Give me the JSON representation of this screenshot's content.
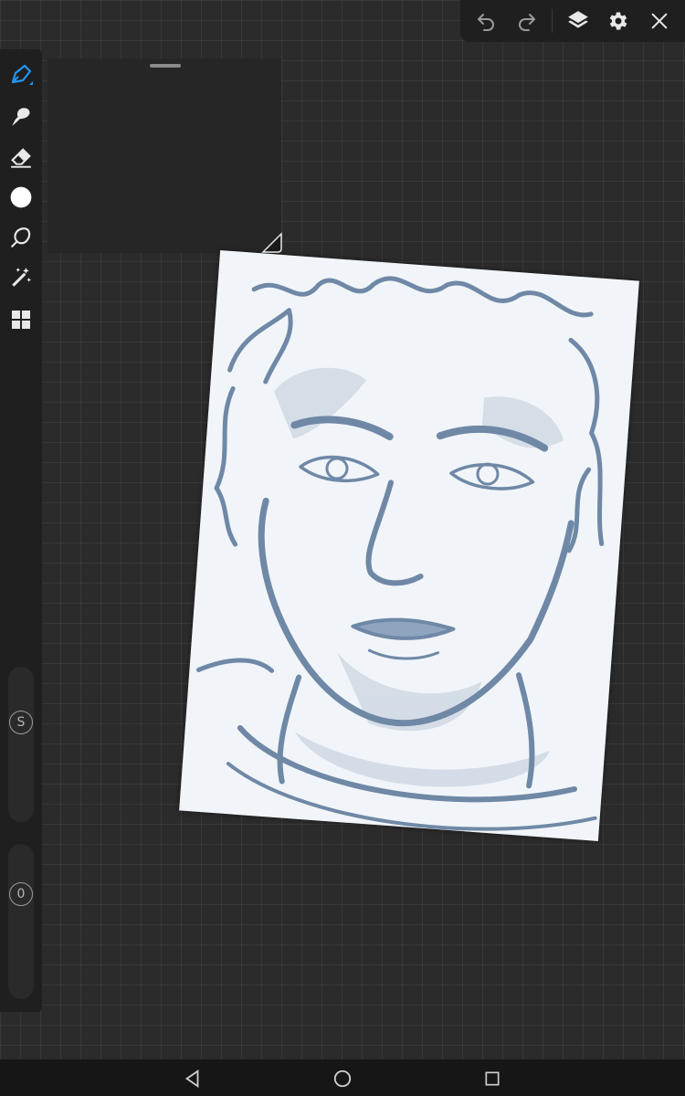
{
  "toolbar": {
    "icons": [
      "undo-icon",
      "redo-icon",
      "layers-icon",
      "settings-icon",
      "close-icon"
    ]
  },
  "tools": {
    "items": [
      "pen-icon",
      "smudge-icon",
      "eraser-icon",
      "color-icon",
      "lasso-icon",
      "magic-wand-icon",
      "apps-icon"
    ],
    "active": "pen-icon"
  },
  "sliders": {
    "size_label": "S",
    "opacity_label": "0"
  },
  "colors": {
    "accent": "#2196f3",
    "ink": "#6f88a6",
    "paper": "#f1f5f9",
    "background": "#2b2b2b"
  },
  "navigation": {
    "icons": [
      "back-icon",
      "home-icon",
      "recents-icon"
    ]
  }
}
